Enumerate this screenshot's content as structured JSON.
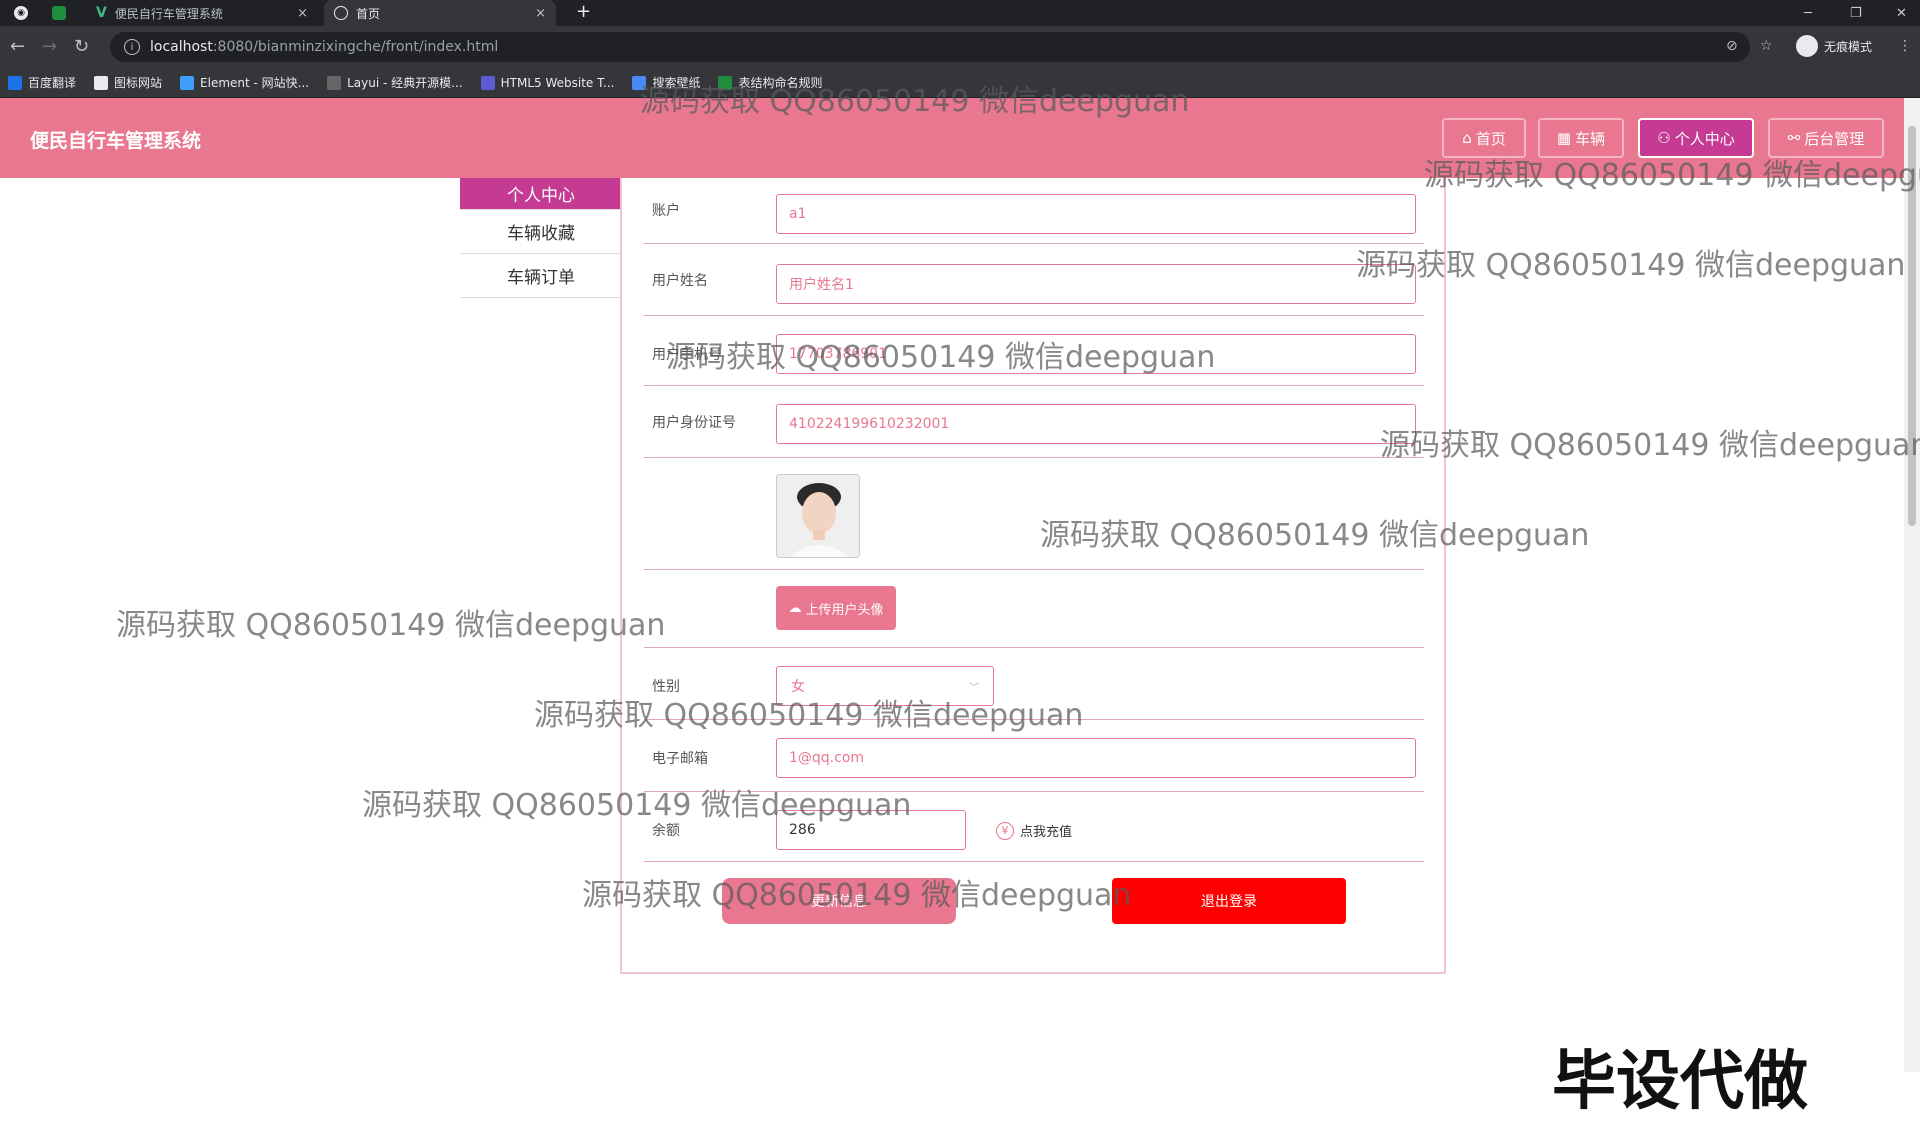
{
  "browser": {
    "tabs": [
      {
        "title": "便民自行车管理系统",
        "close": "×"
      },
      {
        "title": "首页",
        "close": "×"
      }
    ],
    "new_tab": "+",
    "url_host": "localhost",
    "url_rest": ":8080/bianminzixingche/front/index.html",
    "incognito_label": "无痕模式",
    "bookmarks": [
      "百度翻译",
      "图标网站",
      "Element - 网站快...",
      "Layui - 经典开源模...",
      "HTML5 Website T...",
      "搜索壁纸",
      "表结构命名规则"
    ]
  },
  "header": {
    "brand": "便民自行车管理系统",
    "nav": [
      {
        "label": "首页",
        "icon": "home-icon"
      },
      {
        "label": "车辆",
        "icon": "grid-icon"
      },
      {
        "label": "个人中心",
        "icon": "user-icon",
        "active": true
      },
      {
        "label": "后台管理",
        "icon": "link-icon"
      }
    ]
  },
  "sidebar": {
    "items": [
      {
        "label": "个人中心",
        "active": true
      },
      {
        "label": "车辆收藏"
      },
      {
        "label": "车辆订单"
      }
    ]
  },
  "form": {
    "account_label": "账户",
    "account_value": "a1",
    "name_label": "用户姓名",
    "name_value": "用户姓名1",
    "phone_label": "用户手机号",
    "phone_value": "17703786901",
    "idcard_label": "用户身份证号",
    "idcard_value": "410224199610232001",
    "upload_label": "上传用户头像",
    "gender_label": "性别",
    "gender_value": "女",
    "email_label": "电子邮箱",
    "email_value": "1@qq.com",
    "balance_label": "余额",
    "balance_value": "286",
    "recharge_label": "点我充值",
    "update_button": "更新信息",
    "logout_button": "退出登录"
  },
  "watermarks": {
    "text": "源码获取 QQ86050149 微信deepguan",
    "corner": "毕设代做"
  },
  "colors": {
    "header_bg": "#e8778f",
    "active_nav": "#c53b93",
    "logout_red": "#ff0000"
  }
}
